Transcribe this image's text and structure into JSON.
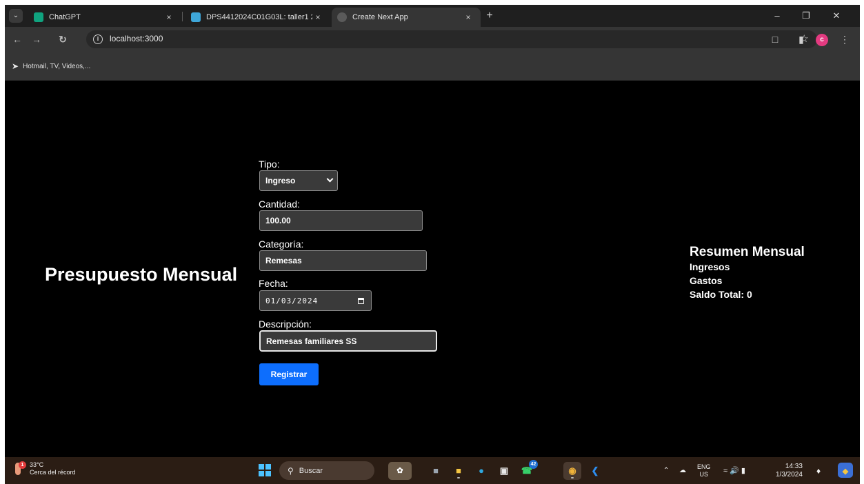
{
  "browser": {
    "tabs": [
      {
        "title": "ChatGPT",
        "favicon_color": "#10a37f"
      },
      {
        "title": "DPS4412024C01G03L: taller1 2(",
        "favicon_color": "#3ea6d8"
      },
      {
        "title": "Create Next App",
        "favicon_color": "#5a5a5a"
      }
    ],
    "active_tab_index": 2,
    "url": "localhost:3000",
    "profile_initial": "c",
    "bookmark": "Hotmail, TV, Videos,..."
  },
  "page": {
    "title": "Presupuesto Mensual",
    "form": {
      "tipo_label": "Tipo:",
      "tipo_value": "Ingreso",
      "cantidad_label": "Cantidad:",
      "cantidad_value": "100.00",
      "categoria_label": "Categoría:",
      "categoria_value": "Remesas",
      "fecha_label": "Fecha:",
      "fecha_value": "01/03/2024",
      "descripcion_label": "Descripción:",
      "descripcion_value": "Remesas familiares SS",
      "submit_label": "Registrar"
    },
    "summary": {
      "title": "Resumen Mensual",
      "ingresos": "Ingresos",
      "gastos": "Gastos",
      "saldo": "Saldo Total: 0"
    }
  },
  "taskbar": {
    "weather_temp": "33°C",
    "weather_desc": "Cerca del récord",
    "weather_alert": "1",
    "search_label": "Buscar",
    "whatsapp_badge": "42",
    "lang_top": "ENG",
    "lang_bottom": "US",
    "time": "14:33",
    "date": "1/3/2024"
  }
}
